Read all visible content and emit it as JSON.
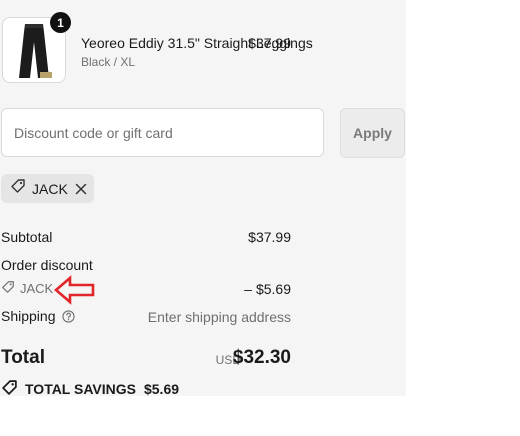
{
  "product": {
    "quantity": "1",
    "name": "Yeoreo Eddiy 31.5\" Straight Leggings",
    "variant": "Black / XL",
    "price": "$37.99"
  },
  "discount": {
    "placeholder": "Discount code or gift card",
    "value": "",
    "apply_label": "Apply",
    "applied_code": "JACK"
  },
  "summary": {
    "subtotal_label": "Subtotal",
    "subtotal_value": "$37.99",
    "order_discount_label": "Order discount",
    "discount_code": "JACK",
    "discount_value": "– $5.69",
    "shipping_label": "Shipping",
    "shipping_value": "Enter shipping address",
    "total_label": "Total",
    "currency": "USD",
    "total_value": "$32.30",
    "savings_label": "TOTAL SAVINGS",
    "savings_value": "$5.69"
  },
  "icons": {
    "tag": "tag-icon",
    "remove": "close-icon",
    "help": "help-circle-icon",
    "arrow": "red-outline-arrow-icon"
  },
  "colors": {
    "panel_bg": "#f5f5f5",
    "muted_text": "#707070",
    "annotation_red": "#e0262a"
  }
}
